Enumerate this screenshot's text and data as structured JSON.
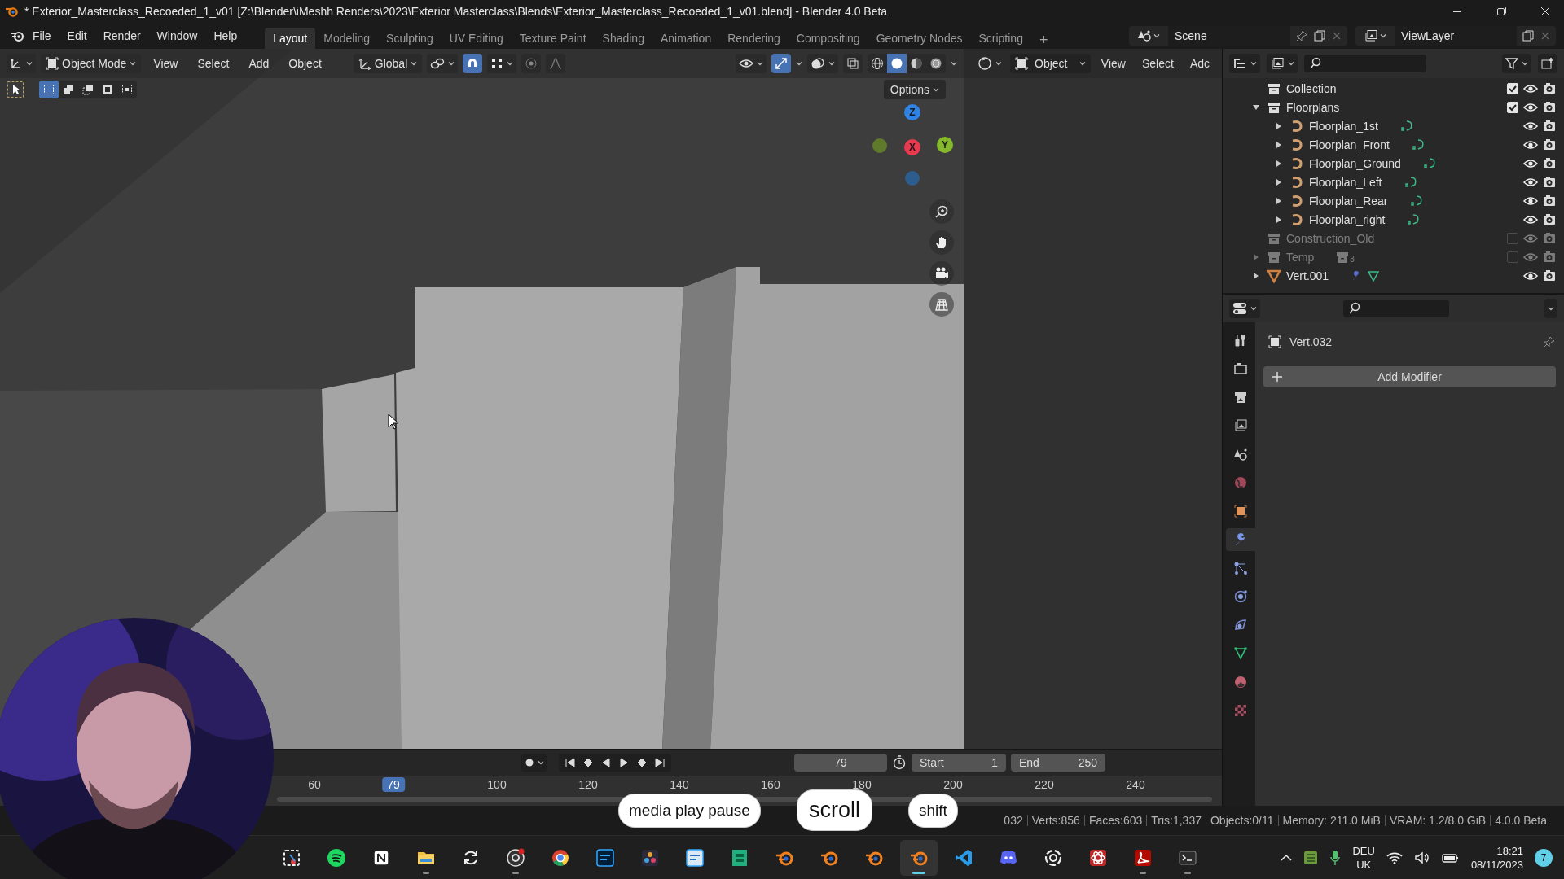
{
  "window": {
    "title": "* Exterior_Masterclass_Recoeded_1_v01 [Z:\\Blender\\iMeshh Renders\\2023\\Exterior Masterclass\\Blends\\Exterior_Masterclass_Recoeded_1_v01.blend] - Blender 4.0 Beta"
  },
  "menu": [
    "File",
    "Edit",
    "Render",
    "Window",
    "Help"
  ],
  "workspaces": [
    {
      "label": "Layout",
      "selected": true
    },
    {
      "label": "Modeling",
      "selected": false
    },
    {
      "label": "Sculpting",
      "selected": false
    },
    {
      "label": "UV Editing",
      "selected": false
    },
    {
      "label": "Texture Paint",
      "selected": false
    },
    {
      "label": "Shading",
      "selected": false
    },
    {
      "label": "Animation",
      "selected": false
    },
    {
      "label": "Rendering",
      "selected": false
    },
    {
      "label": "Compositing",
      "selected": false
    },
    {
      "label": "Geometry Nodes",
      "selected": false
    },
    {
      "label": "Scripting",
      "selected": false
    }
  ],
  "add_workspace": "+",
  "scene": {
    "name": "Scene"
  },
  "view_layer": {
    "name": "ViewLayer"
  },
  "viewport": {
    "mode": "Object Mode",
    "menus": [
      "View",
      "Select",
      "Add",
      "Object"
    ],
    "orientation": "Global",
    "snap": {
      "on": true
    },
    "gizmos": {
      "on": true
    },
    "shading": [
      {
        "kind": "wireframe",
        "selected": false
      },
      {
        "kind": "solid",
        "selected": true
      },
      {
        "kind": "material",
        "selected": false
      },
      {
        "kind": "rendered",
        "selected": false
      }
    ],
    "select_modes": [
      {
        "kind": "new",
        "selected": true
      },
      {
        "kind": "extend",
        "selected": false
      },
      {
        "kind": "subtract",
        "selected": false
      },
      {
        "kind": "invert",
        "selected": false
      },
      {
        "kind": "intersect",
        "selected": false
      }
    ],
    "options": "Options",
    "gizmo_axes": [
      {
        "label": "Z",
        "color": "#2f83e4"
      },
      {
        "label": "X",
        "color": "#e8394f"
      },
      {
        "label": "Y",
        "color": "#86b82c"
      }
    ]
  },
  "side_view": {
    "mode": "Object",
    "menus": [
      "View",
      "Select",
      "Adc"
    ]
  },
  "outliner": {
    "items": [
      {
        "name": "Collection",
        "kind": "collection",
        "checked": true
      },
      {
        "name": "Floorplans",
        "kind": "collection",
        "expanded": true,
        "checked": true,
        "children": [
          {
            "name": "Floorplan_1st",
            "kind": "curve",
            "expanded": false
          },
          {
            "name": "Floorplan_Front",
            "kind": "curve",
            "expanded": false
          },
          {
            "name": "Floorplan_Ground",
            "kind": "curve",
            "expanded": false
          },
          {
            "name": "Floorplan_Left",
            "kind": "curve",
            "expanded": false
          },
          {
            "name": "Floorplan_Rear",
            "kind": "curve",
            "expanded": false
          },
          {
            "name": "Floorplan_right",
            "kind": "curve",
            "expanded": false
          }
        ]
      },
      {
        "name": "Construction_Old",
        "kind": "collection",
        "checked": false
      },
      {
        "name": "Temp",
        "kind": "collection",
        "expanded": false,
        "checked": false,
        "count": "3"
      },
      {
        "name": "Vert.001",
        "kind": "mesh",
        "expanded": false
      }
    ]
  },
  "properties": {
    "tabs": [
      {
        "kind": "tool",
        "selected": false
      },
      {
        "kind": "render",
        "selected": false
      },
      {
        "kind": "output",
        "selected": false
      },
      {
        "kind": "view_layer",
        "selected": false
      },
      {
        "kind": "scene",
        "selected": false
      },
      {
        "kind": "world",
        "selected": false
      },
      {
        "kind": "object",
        "selected": false
      },
      {
        "kind": "modifiers",
        "selected": true
      },
      {
        "kind": "particles",
        "selected": false
      },
      {
        "kind": "physics",
        "selected": false
      },
      {
        "kind": "constraints",
        "selected": false
      },
      {
        "kind": "data",
        "selected": false
      },
      {
        "kind": "material",
        "selected": false
      },
      {
        "kind": "texture",
        "selected": false
      }
    ],
    "object_name": "Vert.032",
    "add_button": "Add Modifier"
  },
  "timeline": {
    "current_frame": "79",
    "start_label": "Start",
    "start": "1",
    "end_label": "End",
    "end": "250",
    "ticks": [
      "60",
      "100",
      "120",
      "140",
      "160",
      "180",
      "200",
      "220",
      "240"
    ],
    "playhead": {
      "label": "79",
      "level": 0.322
    }
  },
  "key_overlays": [
    "media play pause",
    "scroll",
    "shift"
  ],
  "status_bar": [
    "032",
    "Verts:856",
    "Faces:603",
    "Tris:1,337",
    "Objects:0/11",
    "Memory: 211.0 MiB",
    "VRAM: 1.2/8.0 GiB",
    "4.0.0 Beta"
  ],
  "taskbar": {
    "apps": [
      {
        "kind": "snip",
        "running": false,
        "selected": false
      },
      {
        "kind": "music",
        "running": false,
        "selected": false
      },
      {
        "kind": "notes",
        "running": false,
        "selected": false
      },
      {
        "kind": "files",
        "running": true,
        "selected": false
      },
      {
        "kind": "sync",
        "running": false,
        "selected": false
      },
      {
        "kind": "recorder",
        "running": true,
        "selected": false
      },
      {
        "kind": "browser",
        "running": false,
        "selected": false
      },
      {
        "kind": "image_editor",
        "running": false,
        "selected": false
      },
      {
        "kind": "video_editor",
        "running": false,
        "selected": false
      },
      {
        "kind": "image_editor_light",
        "running": false,
        "selected": false
      },
      {
        "kind": "cube_app",
        "running": false,
        "selected": false
      },
      {
        "kind": "blender",
        "running": false,
        "selected": false
      },
      {
        "kind": "blender",
        "running": false,
        "selected": false
      },
      {
        "kind": "blender",
        "running": false,
        "selected": false
      },
      {
        "kind": "blender",
        "running": true,
        "selected": true
      },
      {
        "kind": "code_editor",
        "running": false,
        "selected": false
      },
      {
        "kind": "chat",
        "running": false,
        "selected": false
      },
      {
        "kind": "knot",
        "running": false,
        "selected": false
      },
      {
        "kind": "atom",
        "running": false,
        "selected": false
      },
      {
        "kind": "pdf",
        "running": true,
        "selected": false
      },
      {
        "kind": "terminal",
        "running": true,
        "selected": false
      }
    ],
    "language": "DEU",
    "layout": "UK",
    "time": "18:21",
    "date": "08/11/2023",
    "notifications": "7"
  }
}
